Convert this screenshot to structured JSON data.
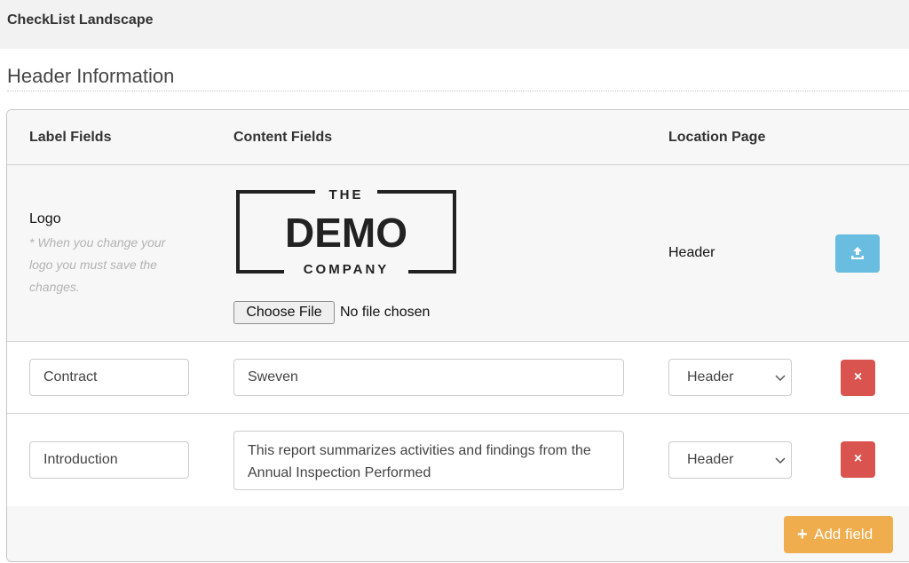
{
  "app": {
    "title": "CheckList Landscape"
  },
  "section": {
    "title": "Header Information"
  },
  "table": {
    "headers": {
      "label": "Label Fields",
      "content": "Content Fields",
      "location": "Location Page"
    },
    "logo_row": {
      "label": "Logo",
      "note": "* When you change your logo you must save the changes.",
      "logo": {
        "line1": "THE",
        "line2": "DEMO",
        "line3": "COMPANY"
      },
      "file_button": "Choose File",
      "file_status": "No file chosen",
      "location": "Header",
      "upload_icon": "upload-icon"
    },
    "rows": [
      {
        "label": "Contract",
        "content": "Sweven",
        "location": "Header",
        "delete_icon": "×"
      },
      {
        "label": "Introduction",
        "content": "This report summarizes activities and findings from the Annual Inspection Performed",
        "location": "Header",
        "delete_icon": "×"
      }
    ]
  },
  "footer": {
    "add_plus": "+",
    "add_label": "Add field"
  },
  "colors": {
    "info": "#69bde0",
    "danger": "#d9534f",
    "warning": "#f0ad4e"
  }
}
